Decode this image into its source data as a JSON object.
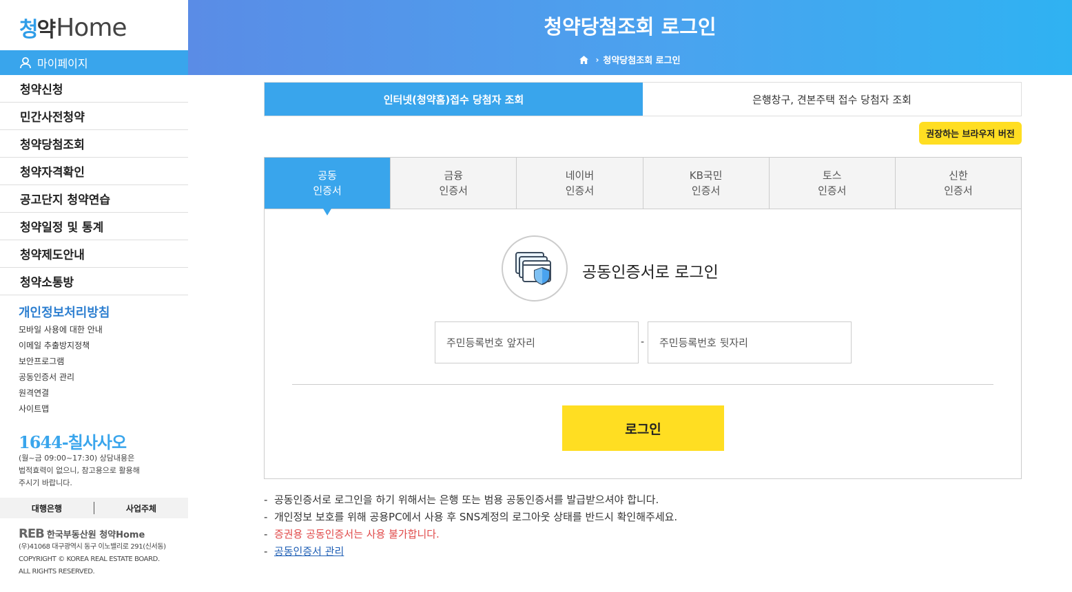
{
  "logo": {
    "kor_accent": "청",
    "kor_rest": "약",
    "eng": "Home"
  },
  "mypage": {
    "label": "마이페이지"
  },
  "menu": [
    {
      "label": "청약신청"
    },
    {
      "label": "민간사전청약"
    },
    {
      "label": "청약당첨조회"
    },
    {
      "label": "청약자격확인"
    },
    {
      "label": "공고단지 청약연습"
    },
    {
      "label": "청약일정 및 통계"
    },
    {
      "label": "청약제도안내"
    },
    {
      "label": "청약소통방"
    }
  ],
  "privacy": "개인정보처리방침",
  "sublinks": [
    "모바일 사용에 대한 안내",
    "이메일 추출방지정책",
    "보안프로그램",
    "공동인증서 관리",
    "원격연결",
    "사이트맵"
  ],
  "phone": "1644-칠사사오",
  "phone_desc": [
    "(월~금 09:00~17:30) 상담내용은",
    "법적효력이 없으니, 참고용으로 활용해",
    "주시기 바랍니다."
  ],
  "bank_bar": {
    "bank": "대행은행",
    "business": "사업주체"
  },
  "footer": {
    "reb": "REB",
    "org": "한국부동산원",
    "brand": "청약Home",
    "lines": [
      "(우)41068 대구광역시 동구 이노밸리로 291(신서동)",
      "COPYRIGHT © KOREA REAL ESTATE BOARD.",
      "ALL RIGHTS RESERVED."
    ]
  },
  "header": {
    "title": "청약당첨조회 로그인",
    "breadcrumb_current": "청약당첨조회 로그인"
  },
  "top_tabs": [
    {
      "label": "인터넷(청약홈)접수 당첨자 조회",
      "active": true
    },
    {
      "label": "은행창구, 견본주택 접수 당첨자 조회",
      "active": false
    }
  ],
  "browser_button": "권장하는 브라우저 버전",
  "cert_tabs": [
    {
      "line1": "공동",
      "line2": "인증서",
      "active": true
    },
    {
      "line1": "금융",
      "line2": "인증서",
      "active": false
    },
    {
      "line1": "네이버",
      "line2": "인증서",
      "active": false
    },
    {
      "line1": "KB국민",
      "line2": "인증서",
      "active": false
    },
    {
      "line1": "토스",
      "line2": "인증서",
      "active": false
    },
    {
      "line1": "신한",
      "line2": "인증서",
      "active": false
    }
  ],
  "login": {
    "title": "공동인증서로 로그인",
    "front_placeholder": "주민등록번호 앞자리",
    "back_placeholder": "주민등록번호 뒷자리",
    "dash": "-",
    "button": "로그인"
  },
  "notes": {
    "n1": "공동인증서로 로그인을 하기 위해서는 은행 또는 범용 공동인증서를 발급받으셔야 합니다.",
    "n2": "개인정보 보호를 위해 공용PC에서 사용 후 SNS계정의 로그아웃 상태를 반드시 확인해주세요.",
    "n3": "증권용 공동인증서는 사용 불가합니다.",
    "n4": "공동인증서 관리"
  },
  "colors": {
    "primary": "#39a5ec",
    "yellow": "#ffde22",
    "red_note": "#e04a4a"
  },
  "icons": [
    "user-icon",
    "home-icon",
    "certificate-shield-icon"
  ]
}
